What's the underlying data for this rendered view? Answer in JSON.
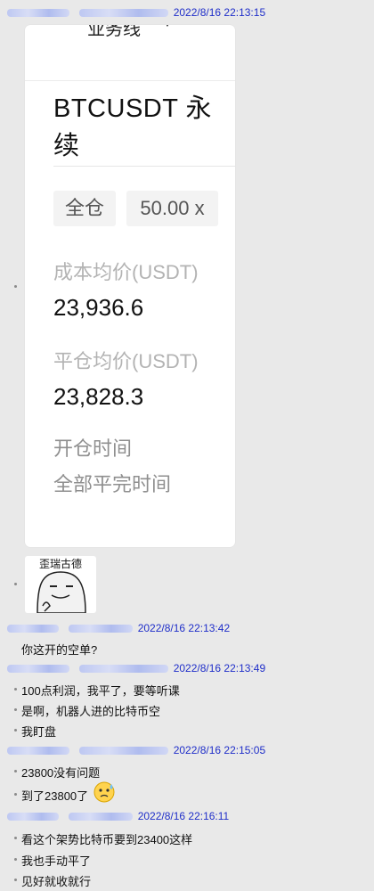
{
  "messages": [
    {
      "time": "2022/8/16 22:13:15"
    },
    {
      "time": "2022/8/16 22:13:42",
      "lines": [
        "你这开的空单?"
      ]
    },
    {
      "time": "2022/8/16 22:13:49",
      "lines": [
        "100点利润，我平了，要等听课",
        "是啊，机器人进的比特币空",
        "我盯盘"
      ]
    },
    {
      "time": "2022/8/16 22:15:05",
      "lines": [
        "23800没有问题",
        "到了23800了"
      ]
    },
    {
      "time": "2022/8/16 22:16:11",
      "lines": [
        "看这个架势比特币要到23400这样",
        "我也手动平了",
        "见好就收就行"
      ]
    }
  ],
  "card": {
    "cut_text": "业务线",
    "title": "BTCUSDT  永续",
    "margin_mode": "全仓",
    "leverage": "50.00 x",
    "avg_cost_label": "成本均价(USDT)",
    "avg_cost_value": "23,936.6",
    "avg_close_label": "平仓均价(USDT)",
    "avg_close_value": "23,828.3",
    "open_time_label": "开仓时间",
    "close_time_label": "全部平完时间"
  },
  "sticker": {
    "caption": "歪瑞古德"
  },
  "icons": {
    "sticker_icon": "smug-doge-icon",
    "emoji_icon": "thinking-sweat-emoji-icon"
  },
  "colors": {
    "timestamp": "#1f2ec9",
    "background": "#e9e9e9"
  }
}
